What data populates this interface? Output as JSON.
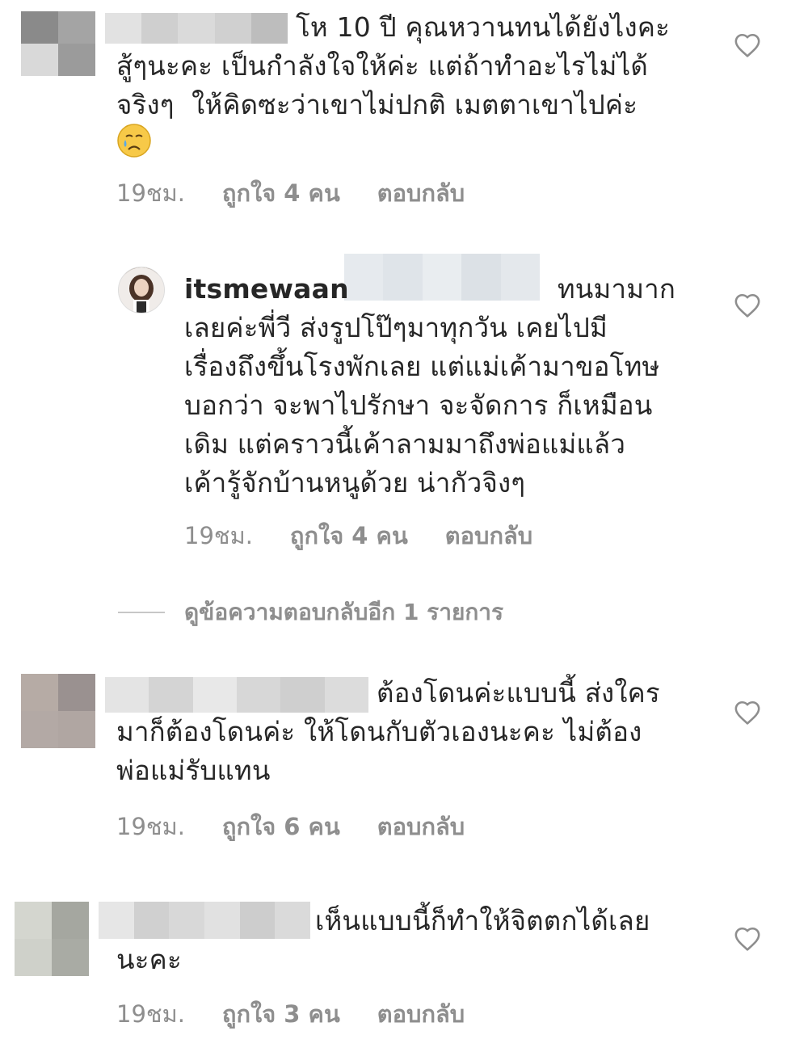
{
  "comments": [
    {
      "text": "โห 10 ปี คุณหวานทนได้ยังไงคะ\nสู้ๆนะคะ เป็นกำลังใจให้ค่ะ แต่ถ้าทำอะไรไม่ได้\nจริงๆ  ให้คิดซะว่าเขาไม่ปกติ เมตตาเขาไปค่ะ",
      "time": "19ชม.",
      "likes": "ถูกใจ 4 คน",
      "reply": "ตอบกลับ",
      "emoji_icon": "crying-face-emoji"
    },
    {
      "username": "itsmewaan",
      "text_first": "ทนมามาก",
      "text_rest": "เลยค่ะพี่วี ส่งรูปโป๊ๆมาทุกวัน เคยไปมี\nเรื่องถึงขึ้นโรงพักเลย แต่แม่เค้ามาขอโทษ\nบอกว่า จะพาไปรักษา จะจัดการ ก็เหมือน\nเดิม แต่คราวนี้เค้าลามมาถึงพ่อแม่แล้ว\nเค้ารู้จักบ้านหนูด้วย น่ากัวจิงๆ",
      "time": "19ชม.",
      "likes": "ถูกใจ 4 คน",
      "reply": "ตอบกลับ"
    },
    {
      "text": "ต้องโดนค่ะแบบนี้ ส่งใคร\nมาก็ต้องโดนค่ะ ให้โดนกับตัวเองนะคะ ไม่ต้อง\nพ่อแม่รับแทน",
      "time": "19ชม.",
      "likes": "ถูกใจ 6 คน",
      "reply": "ตอบกลับ"
    },
    {
      "text": "เห็นแบบนี้ก็ทำให้จิตตกได้เลย\nนะคะ",
      "time": "19ชม.",
      "likes": "ถูกใจ 3 คน",
      "reply": "ตอบกลับ"
    }
  ],
  "view_replies_label": "ดูข้อความตอบกลับอีก 1 รายการ",
  "icons": {
    "like": "heart-outline-icon"
  },
  "colors": {
    "text": "#262626",
    "meta": "#8e8e8e",
    "icon": "#8e8e8e"
  }
}
